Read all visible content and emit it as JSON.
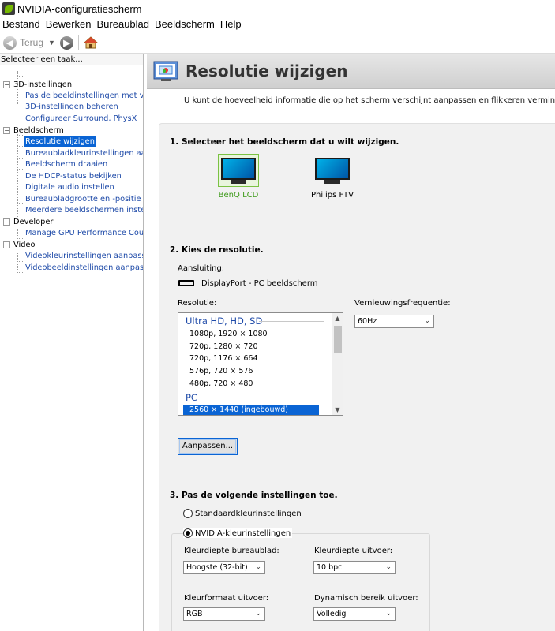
{
  "window": {
    "title": "NVIDIA-configuratiescherm"
  },
  "menu": [
    "Bestand",
    "Bewerken",
    "Bureaublad",
    "Beeldscherm",
    "Help"
  ],
  "toolbar": {
    "back_label": "Terug"
  },
  "left_panel": {
    "header": "Selecteer een taak...",
    "categories": [
      {
        "label": "3D-instellingen",
        "items": [
          "Pas de beeldinstellingen met voorbe",
          "3D-instellingen beheren",
          "Configureer Surround, PhysX"
        ]
      },
      {
        "label": "Beeldscherm",
        "items": [
          "Resolutie wijzigen",
          "Bureaubladkleurinstellingen aanpass",
          "Beeldscherm draaien",
          "De HDCP-status bekijken",
          "Digitale audio instellen",
          "Bureaubladgrootte en -positie aanpa",
          "Meerdere beeldschermen instellen"
        ]
      },
      {
        "label": "Developer",
        "items": [
          "Manage GPU Performance Counters"
        ]
      },
      {
        "label": "Video",
        "items": [
          "Videokleurinstellingen aanpassen",
          "Videobeeldinstellingen aanpassen"
        ]
      }
    ],
    "selected_item": "Resolutie wijzigen"
  },
  "main": {
    "title": "Resolutie wijzigen",
    "intro": "U kunt de hoeveelheid informatie die op het scherm verschijnt aanpassen en flikkeren verminderen. U kunt oo",
    "section1": {
      "title": "1. Selecteer het beeldscherm dat u wilt wijzigen.",
      "displays": [
        {
          "label": "BenQ LCD",
          "selected": true
        },
        {
          "label": "Philips FTV",
          "selected": false
        }
      ]
    },
    "section2": {
      "title": "2. Kies de resolutie.",
      "connection_label": "Aansluiting:",
      "connection_value": "DisplayPort - PC beeldscherm",
      "resolution_label": "Resolutie:",
      "resolution_groups": [
        {
          "header": "Ultra HD, HD, SD",
          "items": [
            "1080p, 1920 × 1080",
            "720p, 1280 × 720",
            "720p, 1176 × 664",
            "576p, 720 × 576",
            "480p, 720 × 480"
          ]
        },
        {
          "header": "PC",
          "items": [
            "2560 × 1440 (ingebouwd)"
          ]
        }
      ],
      "selected_resolution": "2560 × 1440 (ingebouwd)",
      "refresh_label": "Vernieuwingsfrequentie:",
      "refresh_value": "60Hz",
      "customize_button": "Aanpassen..."
    },
    "section3": {
      "title": "3. Pas de volgende instellingen toe.",
      "radio_default": "Standaardkleurinstellingen",
      "radio_nvidia": "NVIDIA-kleurinstellingen",
      "selected_radio": "NVIDIA-kleurinstellingen",
      "fields": {
        "desktop_depth_label": "Kleurdiepte bureaublad:",
        "desktop_depth_value": "Hoogste (32-bit)",
        "output_depth_label": "Kleurdiepte uitvoer:",
        "output_depth_value": "10 bpc",
        "output_format_label": "Kleurformaat uitvoer:",
        "output_format_value": "RGB",
        "dynamic_range_label": "Dynamisch bereik uitvoer:",
        "dynamic_range_value": "Volledig"
      }
    }
  },
  "colors": {
    "selection": "#0a64d4",
    "link": "#1e4aa8",
    "nvidia_green": "#76b900",
    "selected_display_text": "#3f9b1b"
  }
}
